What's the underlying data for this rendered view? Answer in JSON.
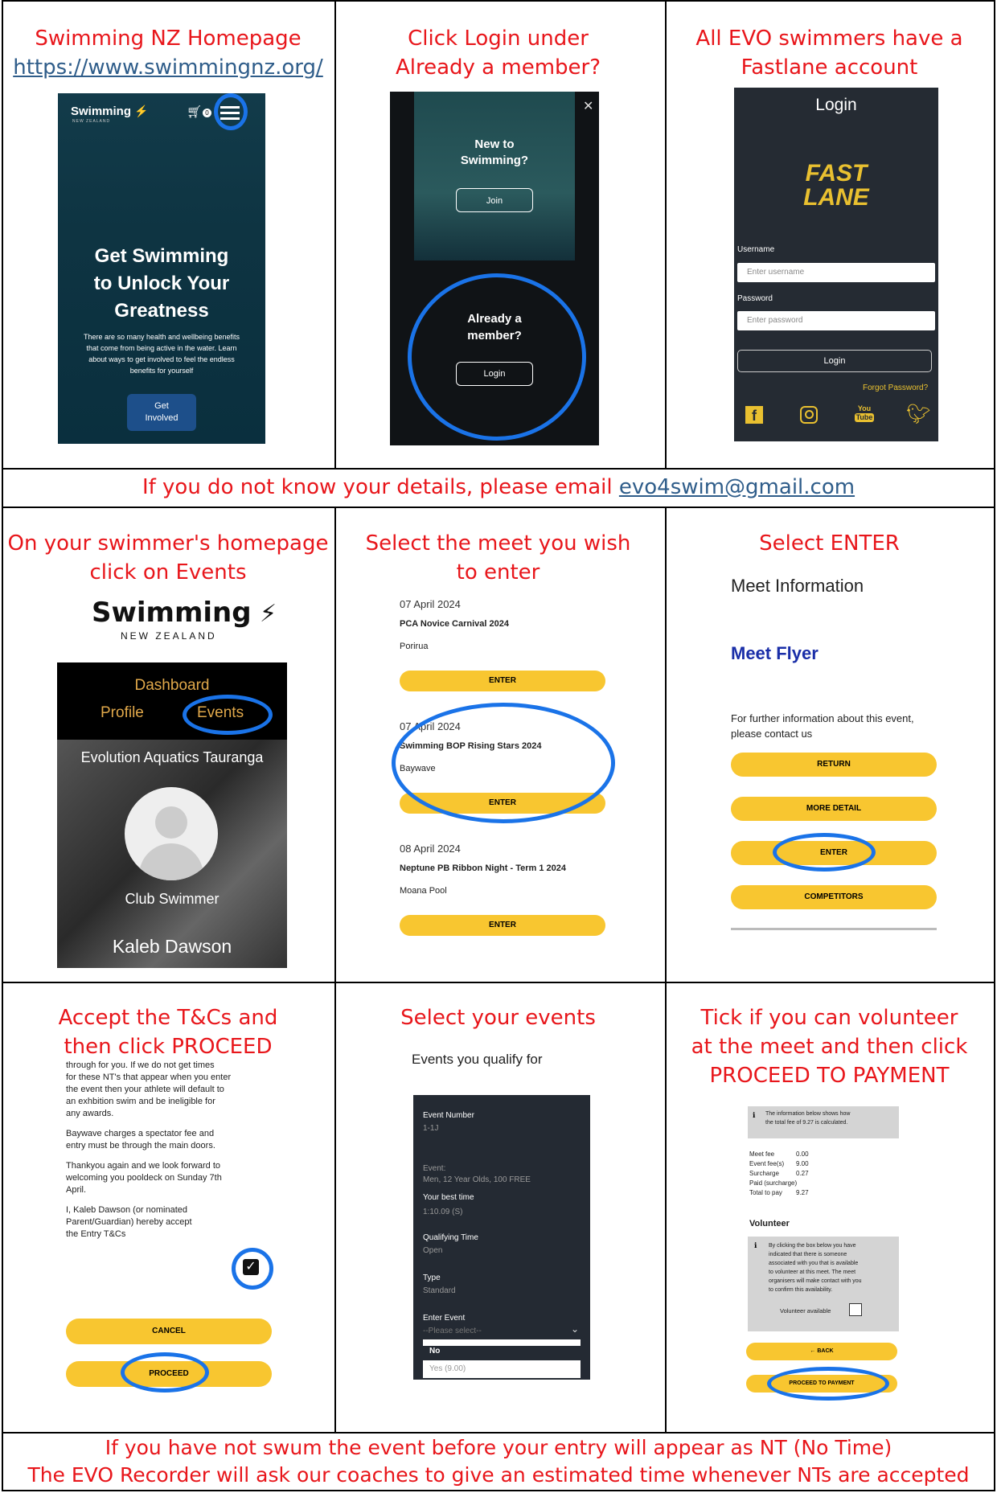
{
  "row1": {
    "cell1": {
      "title": "Swimming NZ Homepage",
      "url": "https://www.swimmingnz.org/",
      "phone": {
        "logo_main": "Swimming",
        "logo_sub": "NEW ZEALAND",
        "cart_count": "0",
        "hero_title_1": "Get Swimming",
        "hero_title_2": "to Unlock Your",
        "hero_title_3": "Greatness",
        "hero_text_1": "There are so many health and wellbeing benefits",
        "hero_text_2": "that come from being active in the water. Learn",
        "hero_text_3": "about ways to get involved to feel the endless",
        "hero_text_4": "benefits for yourself",
        "cta_1": "Get",
        "cta_2": "Involved"
      }
    },
    "cell2": {
      "title_1": "Click Login under",
      "title_2": "Already a member?",
      "phone": {
        "new_1": "New to",
        "new_2": "Swimming?",
        "join": "Join",
        "member_1": "Already a",
        "member_2": "member?",
        "login": "Login"
      }
    },
    "cell3": {
      "title_1": "All EVO swimmers have a",
      "title_2": "Fastlane account",
      "phone": {
        "heading": "Login",
        "brand_1": "FAST",
        "brand_2": "LANE",
        "username_label": "Username",
        "username_placeholder": "Enter username",
        "password_label": "Password",
        "password_placeholder": "Enter password",
        "login_button": "Login",
        "forgot": "Forgot Password?",
        "yt_1": "You",
        "yt_2": "Tube"
      }
    }
  },
  "notice": {
    "text": "If you do not know your details, please email ",
    "email": "evo4swim@gmail.com"
  },
  "row2": {
    "cell1": {
      "title_1": "On your swimmer's homepage",
      "title_2": "click on Events",
      "logo_main": "Swimming",
      "logo_sub": "NEW ZEALAND",
      "dashboard": "Dashboard",
      "profile": "Profile",
      "events": "Events",
      "club": "Evolution Aquatics Tauranga",
      "role": "Club Swimmer",
      "name": "Kaleb Dawson"
    },
    "cell2": {
      "title_1": "Select the meet you wish",
      "title_2": "to enter",
      "meets": [
        {
          "date": "07 April 2024",
          "name": "PCA Novice Carnival 2024",
          "venue": "Porirua",
          "button": "ENTER"
        },
        {
          "date": "07 April 2024",
          "name": "Swimming BOP Rising Stars 2024",
          "venue": "Baywave",
          "button": "ENTER"
        },
        {
          "date": "08 April 2024",
          "name": "Neptune PB Ribbon Night - Term 1 2024",
          "venue": "Moana Pool",
          "button": "ENTER"
        }
      ]
    },
    "cell3": {
      "title": "Select ENTER",
      "heading": "Meet Information",
      "flyer": "Meet Flyer",
      "info_1": "For further information about this event,",
      "info_2": "please contact us",
      "buttons": [
        "RETURN",
        "MORE DETAIL",
        "ENTER",
        "COMPETITORS"
      ]
    }
  },
  "row3": {
    "cell1": {
      "title_1": "Accept the T&Cs and",
      "title_2": "then click PROCEED",
      "lines": [
        "through for you.  If we do not get times",
        "for these NT's that appear when you enter",
        "the event then your athlete will default to",
        "an exhbition swim and be ineligible for",
        "any awards.",
        "",
        "Baywave charges a spectator fee and",
        "entry must be through the main doors.",
        "",
        "Thankyou again and we look forward to",
        "welcoming you pooldeck on Sunday 7th",
        "April.",
        "",
        "I, Kaleb Dawson (or nominated",
        "Parent/Guardian) hereby accept",
        "the Entry T&Cs"
      ],
      "cancel": "CANCEL",
      "proceed": "PROCEED"
    },
    "cell2": {
      "title": "Select your events",
      "heading": "Events you qualify for",
      "fields": [
        {
          "label": "Event Number",
          "value": "1-1J"
        },
        {
          "label": "",
          "value": "Event:"
        },
        {
          "label": "",
          "value": "Men, 12 Year Olds, 100 FREE"
        },
        {
          "label": "Your best time",
          "value": "1:10.09 (S)"
        },
        {
          "label": "Qualifying Time",
          "value": "Open"
        },
        {
          "label": "Type",
          "value": "Standard"
        },
        {
          "label": "Enter Event",
          "value": "--Please select--"
        }
      ],
      "option_no": "No",
      "option_yes": "Yes (9.00)"
    },
    "cell3": {
      "title_1": "Tick if you can volunteer",
      "title_2": "at the meet and then click",
      "title_3": "PROCEED TO PAYMENT",
      "info_1": "The information below shows how",
      "info_2": "the total fee of 9.27 is calculated.",
      "fees": [
        {
          "label": "Meet fee",
          "value": "0.00"
        },
        {
          "label": "Event fee(s)",
          "value": "9.00"
        },
        {
          "label": "Surcharge",
          "value": "0.27"
        },
        {
          "label": "Paid (surcharge)",
          "value": ""
        },
        {
          "label": "Total to pay",
          "value": "9.27"
        }
      ],
      "volunteer_heading": "Volunteer",
      "vol_lines": [
        "By clicking the box below you have",
        "indicated that there is someone",
        "associated with you that is available",
        "to volunteer at this meet. The meet",
        "organisers will make contact with you",
        "to confirm this availability."
      ],
      "vol_label": "Volunteer available",
      "back": "← BACK",
      "proceed": "PROCEED TO PAYMENT"
    }
  },
  "footer": {
    "line_1": "If you have not swum the event before your entry will appear as NT (No Time)",
    "line_2": "The EVO Recorder will ask our coaches to give an estimated time whenever NTs are accepted"
  }
}
